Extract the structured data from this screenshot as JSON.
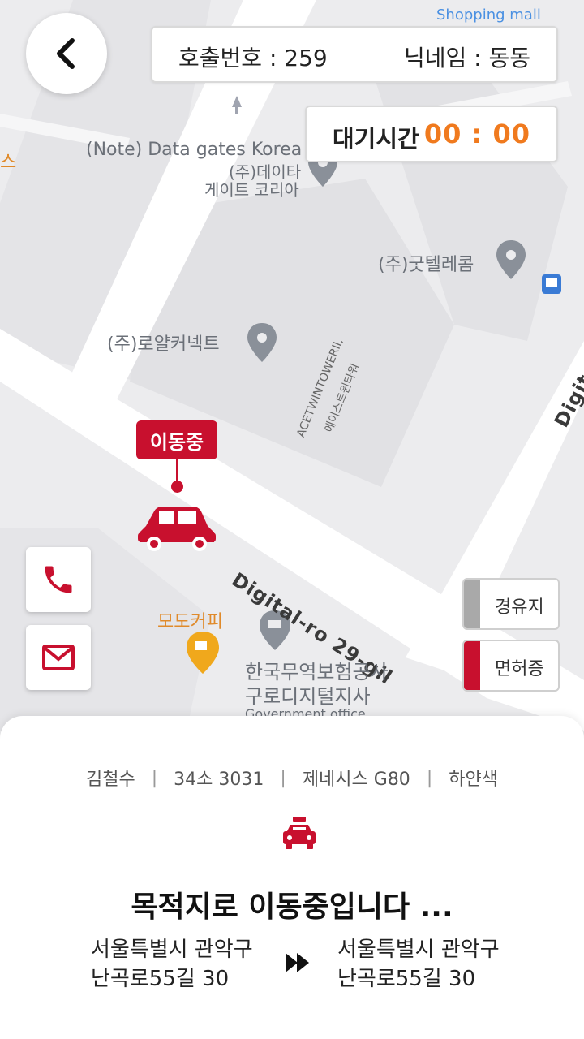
{
  "header": {
    "call_number": "호출번호 : 259",
    "nickname": "닉네임 : 동동",
    "wait_label": "대기시간",
    "wait_time": "00 : 00"
  },
  "map": {
    "labels": {
      "shopping_mall": "Shopping mall",
      "note_data_gates": "(Note) Data gates Korea",
      "data_gates_kr_1": "(주)데이타",
      "data_gates_kr_2": "게이트 코리아",
      "goodtelecom": "(주)굿텔레콤",
      "royal_connect": "(주)로얄커넥트",
      "ace_twin_tower": "ACETWINTOWERII,",
      "ace_twin_tower_kr": "에이스트윈타워",
      "road_main": "Digital-ro 29-gil",
      "road_right": "Digital",
      "cafe": "모도커피",
      "kotra_1": "한국무역보험공사",
      "kotra_2": "구로디지털지사",
      "gov_office": "Government office",
      "partial_left": "스"
    },
    "moving_tag": "이동중"
  },
  "side_tags": {
    "refuel": "경유지",
    "license": "면허증"
  },
  "trip": {
    "driver_name": "김철수",
    "car_plate": "34소 3031",
    "car_model": "제네시스 G80",
    "car_color": "하얀색",
    "status": "목적지로 이동중입니다 ...",
    "from_line1": "서울특별시 관악구",
    "from_line2": "난곡로55길 30",
    "to_line1": "서울특별시 관악구",
    "to_line2": "난곡로55길 30"
  },
  "colors": {
    "accent": "#c8102e",
    "timer": "#f07a1e",
    "gray_bar": "#a9a9a9"
  },
  "icons": [
    "back-icon",
    "phone-icon",
    "mail-icon",
    "car-icon",
    "taxi-icon",
    "fast-forward-icon",
    "map-pin-icon",
    "bus-icon",
    "coffee-icon",
    "landmark-icon"
  ]
}
